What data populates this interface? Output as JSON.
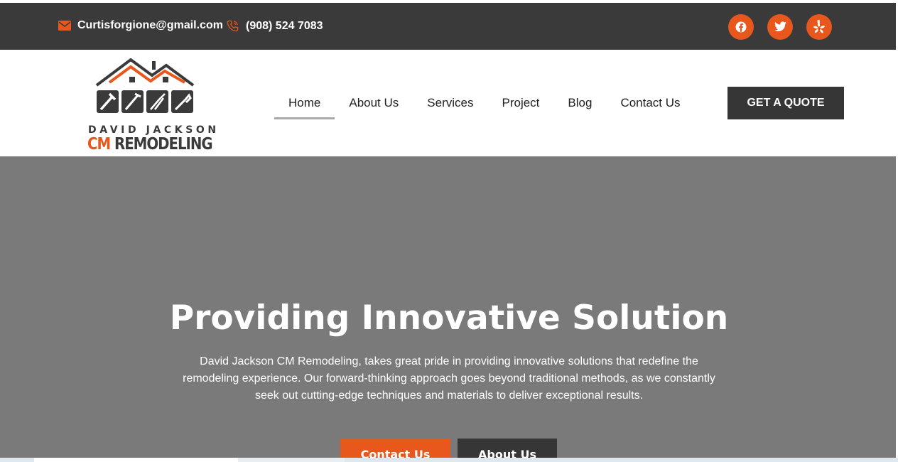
{
  "topbar": {
    "email": "Curtisforgione@gmail.com",
    "phone": "(908) 524 7083",
    "email_icon": "envelope-icon",
    "phone_icon": "phone-icon",
    "social": [
      "facebook-icon",
      "twitter-icon",
      "yelp-icon"
    ]
  },
  "logo": {
    "line1": "DAVID JACKSON",
    "line2_accent": "CM",
    "line2_rest": " REMODELING"
  },
  "nav": {
    "items": [
      "Home",
      "About Us",
      "Services",
      "Project",
      "Blog",
      "Contact Us"
    ],
    "active": "Home"
  },
  "cta": {
    "quote_label": "GET A QUOTE"
  },
  "hero": {
    "title": "Providing Innovative Solution",
    "text": "David Jackson CM Remodeling, takes great pride in providing innovative solutions that redefine the remodeling experience. Our forward-thinking approach goes beyond traditional methods, as we constantly seek out cutting-edge techniques and materials to deliver exceptional results.",
    "contact_label": "Contact Us",
    "about_label": "About Us"
  },
  "colors": {
    "accent": "#e8571b",
    "dark": "#3a3a3a",
    "hero_bg": "#7a7a7a"
  }
}
